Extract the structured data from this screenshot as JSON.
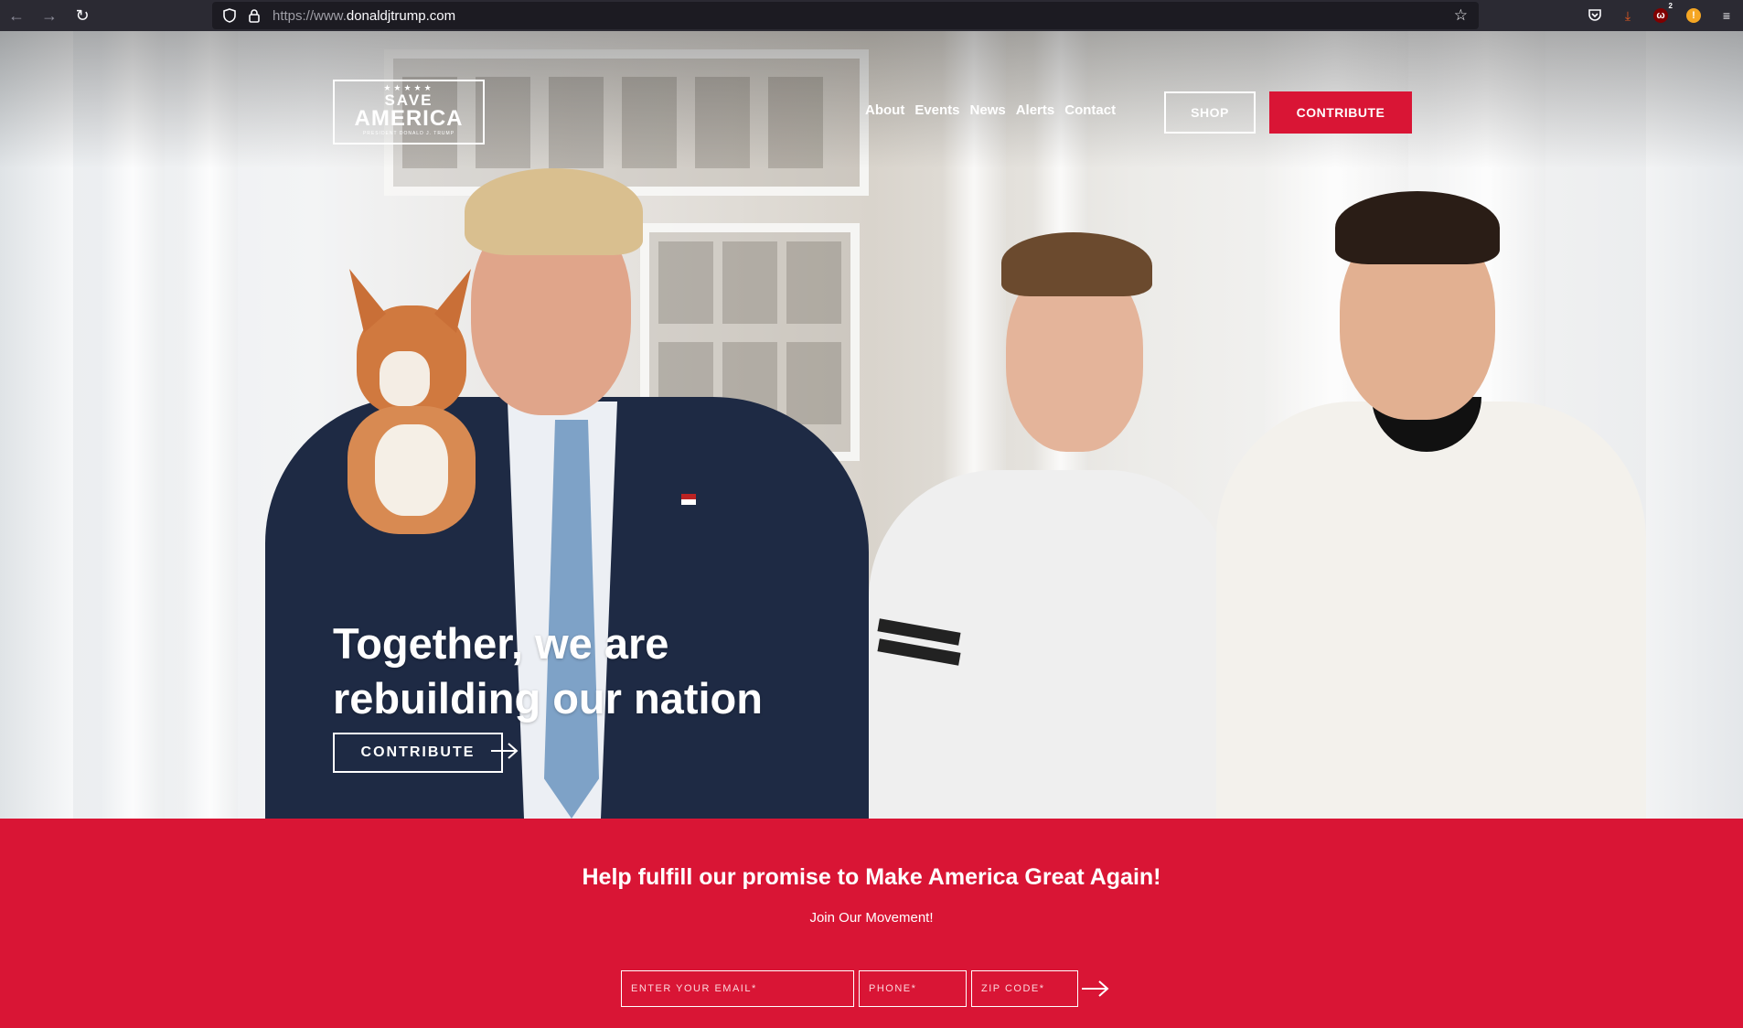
{
  "browser": {
    "url_prefix": "https://www.",
    "url_domain": "donaldjtrump.com",
    "ext_badge": "2"
  },
  "header": {
    "logo": {
      "stars": "★★★★★",
      "line1": "SAVE",
      "line2": "AMERICA",
      "line3": "PRESIDENT DONALD J. TRUMP"
    },
    "nav": [
      "About",
      "Events",
      "News",
      "Alerts",
      "Contact"
    ],
    "shop_label": "SHOP",
    "contribute_label": "CONTRIBUTE"
  },
  "hero": {
    "title_line1": "Together, we are",
    "title_line2": "rebuilding our nation",
    "cta_label": "CONTRIBUTE"
  },
  "band": {
    "title": "Help fulfill our promise to Make America Great Again!",
    "subtitle": "Join Our Movement!",
    "email_placeholder": "ENTER YOUR EMAIL*",
    "phone_placeholder": "PHONE*",
    "zip_placeholder": "ZIP CODE*"
  },
  "colors": {
    "brand_red": "#d91535",
    "chrome_bg": "#2b2a33"
  }
}
